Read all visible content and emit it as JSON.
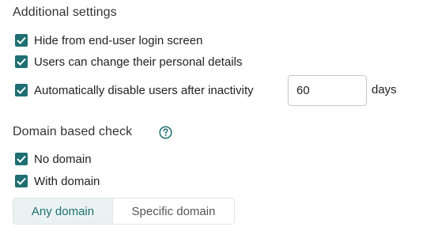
{
  "additional": {
    "title": "Additional settings",
    "options": [
      {
        "label": "Hide from end-user login screen",
        "checked": true
      },
      {
        "label": "Users can change their personal details",
        "checked": true
      },
      {
        "label": "Automatically disable users after inactivity",
        "checked": true
      }
    ],
    "inactivity": {
      "value": "60",
      "unit": "days"
    }
  },
  "domain": {
    "title": "Domain based check",
    "help_icon": "question-circle-icon",
    "options": [
      {
        "label": "No domain",
        "checked": true
      },
      {
        "label": "With domain",
        "checked": true
      }
    ],
    "segments": [
      {
        "label": "Any domain",
        "selected": true
      },
      {
        "label": "Specific domain",
        "selected": false
      }
    ]
  },
  "colors": {
    "accent": "#1f6f72",
    "segment_active_bg": "#eaf2f2"
  }
}
